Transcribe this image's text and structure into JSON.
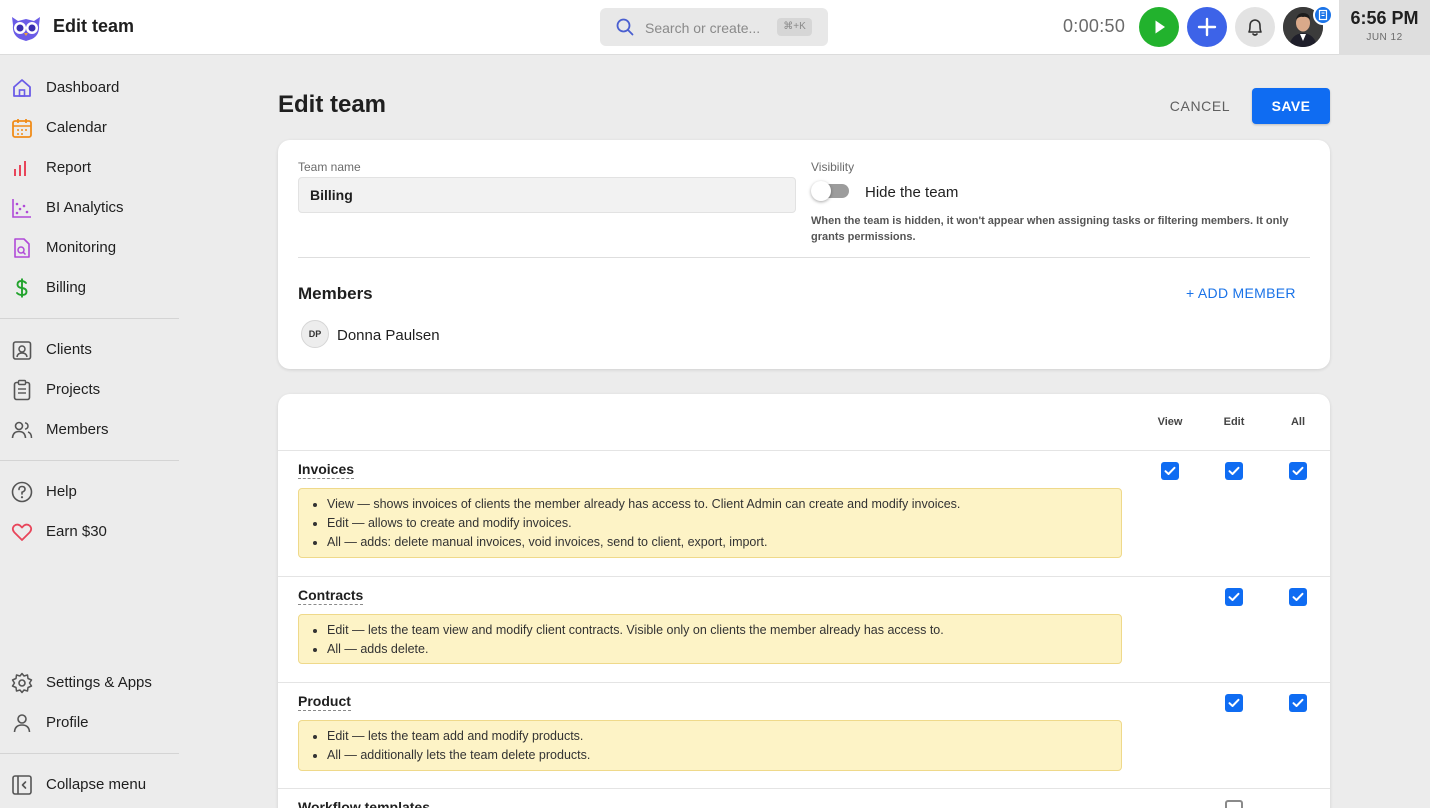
{
  "topbar": {
    "title": "Edit team",
    "search_placeholder": "Search or create...",
    "search_shortcut": "⌘+K",
    "timer": "0:00:50",
    "clock_time": "6:56 PM",
    "clock_date": "JUN 12"
  },
  "sidebar": {
    "items": [
      {
        "label": "Dashboard",
        "icon": "home-icon",
        "color": "#6b5ce7"
      },
      {
        "label": "Calendar",
        "icon": "calendar-icon",
        "color": "#f08c1a"
      },
      {
        "label": "Report",
        "icon": "bar-chart-icon",
        "color": "#e8455a"
      },
      {
        "label": "BI Analytics",
        "icon": "scatter-chart-icon",
        "color": "#b04ad8"
      },
      {
        "label": "Monitoring",
        "icon": "monitoring-icon",
        "color": "#b04ad8"
      },
      {
        "label": "Billing",
        "icon": "dollar-icon",
        "color": "#22a32d"
      },
      {
        "label": "Clients",
        "icon": "clients-icon",
        "color": "#555555"
      },
      {
        "label": "Projects",
        "icon": "clipboard-icon",
        "color": "#555555"
      },
      {
        "label": "Members",
        "icon": "people-icon",
        "color": "#555555"
      },
      {
        "label": "Help",
        "icon": "help-icon",
        "color": "#555555"
      },
      {
        "label": "Earn $30",
        "icon": "heart-icon",
        "color": "#e8455a"
      },
      {
        "label": "Settings & Apps",
        "icon": "gear-icon",
        "color": "#555555"
      },
      {
        "label": "Profile",
        "icon": "person-icon",
        "color": "#555555"
      },
      {
        "label": "Collapse menu",
        "icon": "collapse-icon",
        "color": "#555555"
      }
    ]
  },
  "page": {
    "title": "Edit team",
    "cancel_label": "CANCEL",
    "save_label": "SAVE"
  },
  "team": {
    "name_label": "Team name",
    "name_value": "Billing",
    "visibility_label": "Visibility",
    "visibility_toggle_label": "Hide the team",
    "visibility_hidden": false,
    "visibility_note": "When the team is hidden, it won't appear when assigning tasks or filtering members. It only grants permissions.",
    "members_title": "Members",
    "add_member_label": "+ ADD MEMBER",
    "members": [
      {
        "initials": "DP",
        "name": "Donna Paulsen"
      }
    ]
  },
  "permissions": {
    "columns": [
      "View",
      "Edit",
      "All"
    ],
    "rows": [
      {
        "title": "Invoices",
        "bullets": [
          "View — shows invoices of clients the member already has access to. Client Admin can create and modify invoices.",
          "Edit — allows to create and modify invoices.",
          "All — adds: delete manual invoices, void invoices, send to client, export, import."
        ],
        "view": true,
        "edit": true,
        "all": true
      },
      {
        "title": "Contracts",
        "bullets": [
          "Edit — lets the team view and modify client contracts. Visible only on clients the member already has access to.",
          "All — adds delete."
        ],
        "view": null,
        "edit": true,
        "all": true
      },
      {
        "title": "Product",
        "bullets": [
          "Edit — lets the team add and modify products.",
          "All — additionally lets the team delete products."
        ],
        "view": null,
        "edit": true,
        "all": true
      },
      {
        "title": "Workflow templates",
        "bullets": [],
        "view": null,
        "edit": false,
        "all": null
      }
    ]
  }
}
